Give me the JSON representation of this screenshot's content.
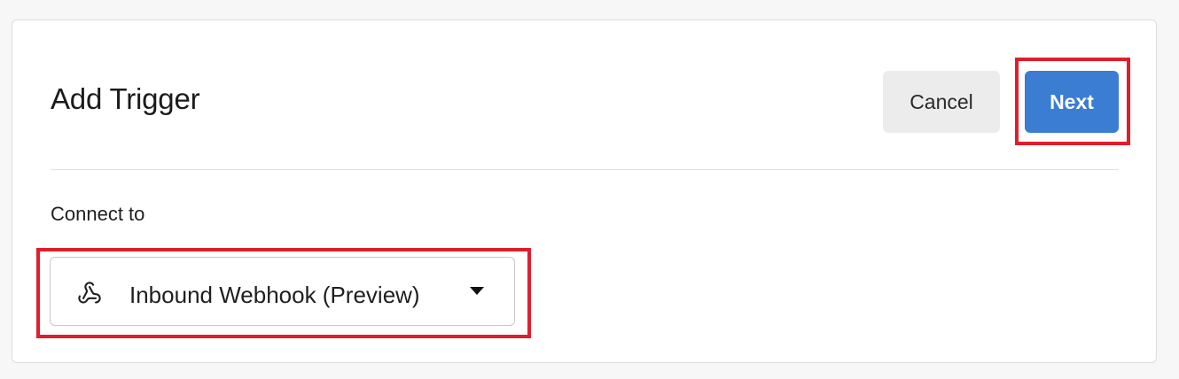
{
  "dialog": {
    "title": "Add Trigger",
    "cancel_label": "Cancel",
    "next_label": "Next"
  },
  "connect": {
    "label": "Connect to",
    "selected_value": "Inbound Webhook (Preview)",
    "icon": "webhook-icon"
  },
  "colors": {
    "primary": "#3a7dd3",
    "secondary_button": "#ececec",
    "highlight": "#e11d2c"
  }
}
